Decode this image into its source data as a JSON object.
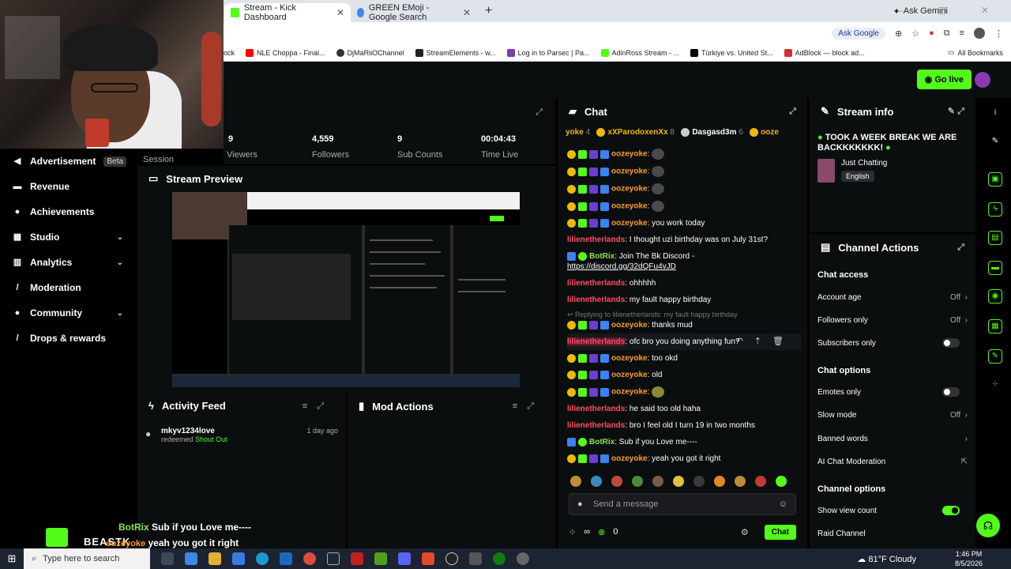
{
  "browser": {
    "tabs": [
      {
        "label": "Stream - Kick Dashboard",
        "active": true,
        "color": "#53fc18"
      },
      {
        "label": "GREEN EMoji - Google Search",
        "active": false,
        "color": "#4285f4"
      }
    ],
    "ask_gemini": "Ask Gemini",
    "ask_google": "Ask Google",
    "bookmarks": [
      {
        "label": "ock",
        "color": "#ffffff"
      },
      {
        "label": "NLE Choppa - Final...",
        "color": "#ff0000"
      },
      {
        "label": "DjMaRiiOChannel",
        "color": "#333333"
      },
      {
        "label": "StreamElements - w...",
        "color": "#222222"
      },
      {
        "label": "Log in to Parsec | Pa...",
        "color": "#7a3ab0"
      },
      {
        "label": "AdinRoss Stream - ...",
        "color": "#53fc18"
      },
      {
        "label": "Türkiye vs. United St...",
        "color": "#000000"
      },
      {
        "label": "AdBlock — block ad...",
        "color": "#d03030"
      }
    ],
    "all_bookmarks": "All Bookmarks"
  },
  "topbar": {
    "go_live": "Go live"
  },
  "nav": {
    "items": [
      {
        "label": "Advertisement",
        "badge": "Beta",
        "icon": "megaphone-icon",
        "chevron": false
      },
      {
        "label": "Revenue",
        "icon": "money-icon",
        "chevron": false
      },
      {
        "label": "Achievements",
        "icon": "trophy-icon",
        "chevron": false
      },
      {
        "label": "Studio",
        "icon": "studio-icon",
        "chevron": true
      },
      {
        "label": "Analytics",
        "icon": "chart-icon",
        "chevron": true
      },
      {
        "label": "Moderation",
        "icon": "sword-icon",
        "chevron": false
      },
      {
        "label": "Community",
        "icon": "people-icon",
        "chevron": true
      },
      {
        "label": "Drops & rewards",
        "icon": "gift-icon",
        "chevron": false
      }
    ]
  },
  "stats": {
    "session_label": "Session",
    "viewers": {
      "value": "9",
      "label": "Viewers"
    },
    "followers": {
      "value": "4,559",
      "label": "Followers"
    },
    "subs": {
      "value": "9",
      "label": "Sub Counts"
    },
    "time": {
      "value": "00:04:43",
      "label": "Time Live"
    }
  },
  "preview": {
    "title": "Stream Preview"
  },
  "activity": {
    "title": "Activity Feed",
    "items": [
      {
        "user": "mkyv1234love",
        "action": "redeemed",
        "reward": "Shout Out",
        "time": "1 day ago"
      }
    ]
  },
  "mod_actions": {
    "title": "Mod Actions"
  },
  "chat": {
    "title": "Chat",
    "pinned": {
      "users": [
        {
          "name": "yoke",
          "count": "4"
        },
        {
          "name": "xXParodoxenXx",
          "count": "8"
        },
        {
          "name": "Dasgasd3m",
          "count": "6"
        },
        {
          "name": "ooze",
          "count": ""
        }
      ]
    },
    "messages": [
      {
        "user": "oozeyoke",
        "text": "",
        "emoji": true,
        "style": "orange",
        "badges": true
      },
      {
        "user": "oozeyoke",
        "text": "",
        "emoji": true,
        "style": "orange",
        "badges": true
      },
      {
        "user": "oozeyoke",
        "text": "",
        "emoji": true,
        "style": "orange",
        "badges": true
      },
      {
        "user": "oozeyoke",
        "text": "",
        "emoji": true,
        "style": "orange",
        "badges": true
      },
      {
        "user": "oozeyoke",
        "text": "you work today",
        "style": "orange",
        "badges": true
      },
      {
        "user": "lilienetherlands",
        "text": "I thought uzi birthday was on July 31st?",
        "style": "red"
      },
      {
        "user": "BotRix",
        "text": "Join The Bk Discord -",
        "link": "https://discord.gg/32dQFu4vJD",
        "style": "lime",
        "bot": true
      },
      {
        "user": "lilienetherlands",
        "text": "ohhhhh",
        "style": "red"
      },
      {
        "user": "lilienetherlands",
        "text": "my fault happy birthday",
        "style": "red"
      },
      {
        "reply": "Replying to lilienetherlands: my fault happy birthday",
        "user": "oozeyoke",
        "text": "thanks mud",
        "style": "orange",
        "badges": true
      },
      {
        "user": "lilienetherlands",
        "text": "ofc bro you doing anything fun?",
        "style": "red",
        "hover": true
      },
      {
        "user": "oozeyoke",
        "text": "too okd",
        "style": "orange",
        "badges": true
      },
      {
        "user": "oozeyoke",
        "text": "old",
        "style": "orange",
        "badges": true
      },
      {
        "user": "oozeyoke",
        "text": "",
        "emoji": true,
        "style": "orange",
        "badges": true
      },
      {
        "user": "lilienetherlands",
        "text": "he said too old haha",
        "style": "red"
      },
      {
        "user": "lilienetherlands",
        "text": "bro I feel old I turn 19 in two months",
        "style": "red"
      },
      {
        "user": "BotRix",
        "text": "Sub if you Love me----",
        "style": "lime",
        "bot": true
      },
      {
        "user": "oozeyoke",
        "text": "yeah you got it right",
        "style": "orange",
        "badges": true
      }
    ],
    "input_placeholder": "Send a message",
    "footer_count": "0",
    "footer_infinity": "∞",
    "send_label": "Chat"
  },
  "stream_info": {
    "title": "Stream info",
    "stream_title": "TOOK A WEEK BREAK WE ARE BACKKKKKKK!",
    "category": "Just Chatting",
    "language": "English"
  },
  "channel_actions": {
    "title": "Channel Actions",
    "chat_access": "Chat access",
    "account_age": {
      "label": "Account age",
      "value": "Off"
    },
    "followers_only": {
      "label": "Followers only",
      "value": "Off"
    },
    "subscribers_only": {
      "label": "Subscribers only",
      "on": false
    },
    "chat_options": "Chat options",
    "emotes_only": {
      "label": "Emotes only",
      "on": false
    },
    "slow_mode": {
      "label": "Slow mode",
      "value": "Off"
    },
    "banned_words": "Banned words",
    "ai_moderation": "AI Chat Moderation",
    "channel_options": "Channel options",
    "show_view_count": {
      "label": "Show view count",
      "on": true
    },
    "raid_channel": "Raid Channel"
  },
  "overlay": {
    "name": "BEASTK",
    "line1_user": "BotRix",
    "line1_text": "Sub if you Love me----",
    "line2_user": "oozeyoke",
    "line2_text": "yeah you got it right"
  },
  "taskbar": {
    "search": "Type here to search",
    "weather": "81°F  Cloudy",
    "time": "1:46 PM",
    "date": "8/5/2026"
  }
}
